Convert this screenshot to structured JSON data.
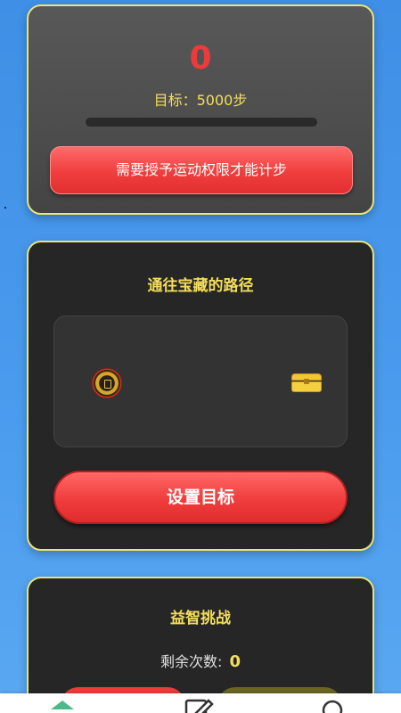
{
  "steps_card": {
    "current_steps": "0",
    "goal_text": "目标：5000步",
    "progress_fraction": 0,
    "permission_button_label": "需要授予运动权限才能计步"
  },
  "path_card": {
    "title": "通往宝藏的路径",
    "start_icon": "coin-icon",
    "end_icon": "treasure-chest-icon",
    "set_goal_button_label": "设置目标"
  },
  "quiz_card": {
    "title": "益智挑战",
    "remaining_label": "剩余次数:",
    "remaining_value": "0"
  },
  "bottom_nav": {
    "items": [
      {
        "icon": "home-icon"
      },
      {
        "icon": "edit-icon"
      },
      {
        "icon": "search-icon"
      }
    ]
  },
  "colors": {
    "accent_red": "#ec3b3b",
    "accent_gold": "#f4dd5a",
    "card_border": "#e9e37a",
    "background_blue": "#4a9bee"
  }
}
